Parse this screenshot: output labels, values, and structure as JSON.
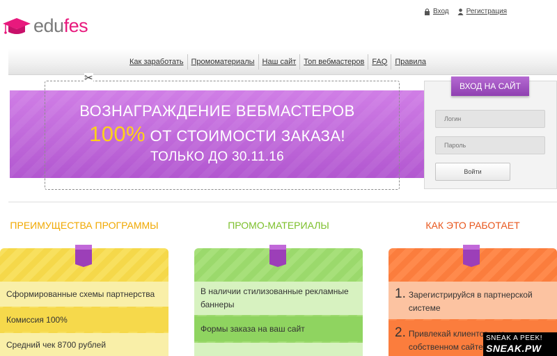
{
  "header": {
    "logo_part1": "edu",
    "logo_part2": "fes",
    "login_link": "Вход",
    "register_link": "Регистрация"
  },
  "nav": {
    "items": [
      "Как заработать",
      "Промоматериалы",
      "Наш сайт",
      "Топ вебмастеров",
      "FAQ",
      "Правила"
    ]
  },
  "banner": {
    "line1": "ВОЗНАГРАЖДЕНИЕ ВЕБМАСТЕРОВ",
    "line2_highlight": "100%",
    "line2_rest": " ОТ СТОИМОСТИ ЗАКАЗА!",
    "line3": "ТОЛЬКО ДО 30.11.16"
  },
  "login_form": {
    "title": "ВХОД НА САЙТ",
    "login_placeholder": "Логин",
    "password_placeholder": "Пароль",
    "submit_label": "Войти"
  },
  "columns": [
    {
      "title": "ПРЕИМУЩЕСТВА ПРОГРАММЫ",
      "title_color": "#f0a800",
      "items": [
        "Сформированные схемы партнерства",
        "Комиссия 100%",
        "Средний чек 8700 рублей"
      ]
    },
    {
      "title": "ПРОМО-МАТЕРИАЛЫ",
      "title_color": "#7cbf2a",
      "items": [
        "В наличии стилизованные рекламные баннеры",
        "Формы заказа на ваш сайт"
      ]
    },
    {
      "title": "КАК ЭТО РАБОТАЕТ",
      "title_color": "#e8561c",
      "steps": [
        {
          "num": "1.",
          "text": "Зарегистрируйся в партнерской системе"
        },
        {
          "num": "2.",
          "text": "Привлекай клиентов - на собственном сайте"
        }
      ]
    }
  ],
  "watermark": {
    "line1": "SNEAK A PEEK!",
    "line2": "SNEAK.PW"
  },
  "colors": {
    "brand_pink": "#e8197d",
    "banner_purple": "#c06ddd",
    "login_tab": "#9e4fc0"
  }
}
